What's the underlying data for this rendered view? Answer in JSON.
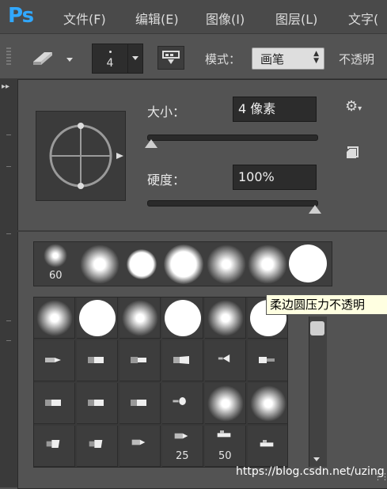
{
  "app": {
    "logo": "Ps"
  },
  "menu": [
    "文件(F)",
    "编辑(E)",
    "图像(I)",
    "图层(L)",
    "文字("
  ],
  "options": {
    "brush_size": "4",
    "mode_label": "模式：",
    "mode_value": "画笔",
    "opacity_label": "不透明"
  },
  "picker": {
    "size_label": "大小：",
    "size_value": "4 像素",
    "size_fraction": 0.01,
    "hardness_label": "硬度：",
    "hardness_value": "100%",
    "hardness_fraction": 1.0,
    "recent_size_label": "60",
    "brush_labels": {
      "b25": "25",
      "b50": "50"
    }
  },
  "tooltip": "柔边圆压力不透明",
  "watermark": "https://blog.csdn.net/uzing",
  "colors": {
    "accent": "#31a8ff",
    "panel": "#535353",
    "field": "#2c2c2c"
  },
  "icons": [
    "eraser-icon",
    "panel-toggle-icon",
    "gear-icon",
    "new-preset-icon",
    "preview-crosshair-icon"
  ]
}
